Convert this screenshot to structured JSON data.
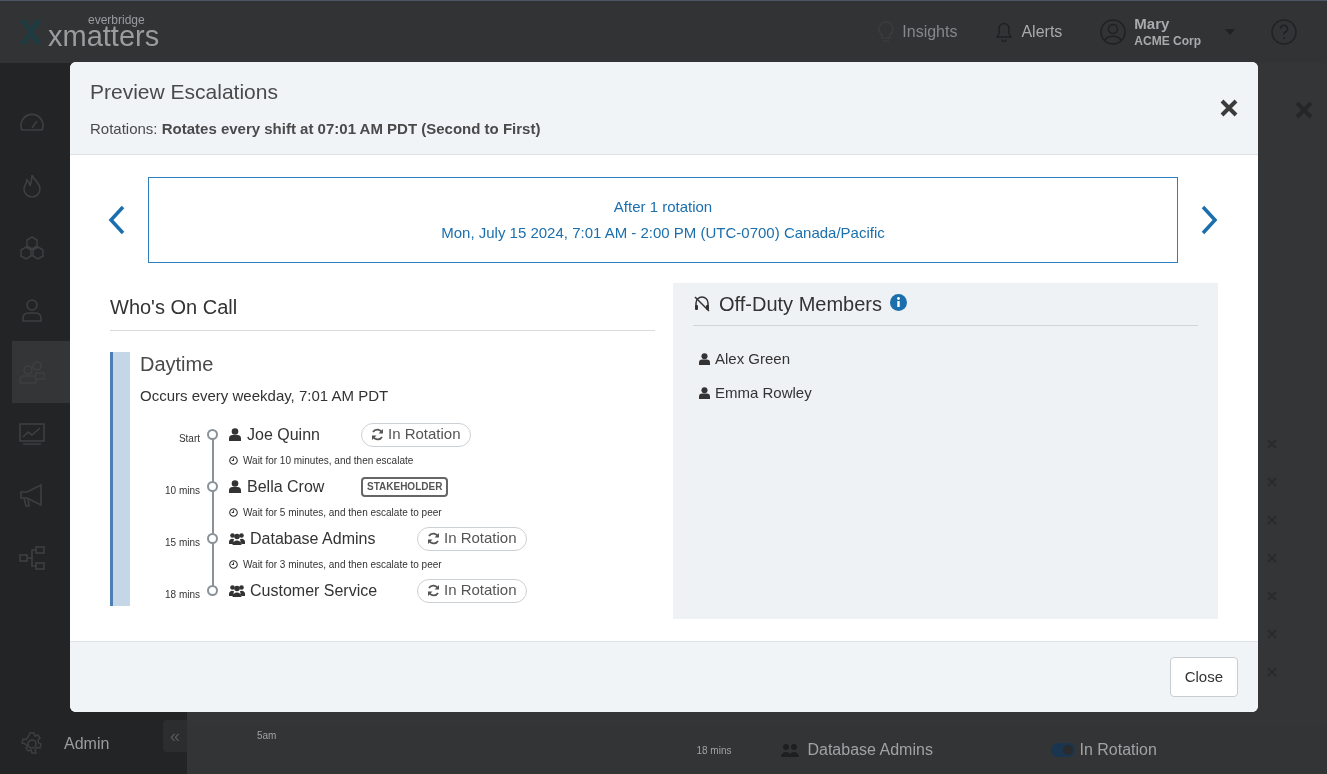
{
  "app": {
    "brand_top": "everbridge",
    "brand": "xmatters",
    "nav": [
      {
        "kind": "insights",
        "label": "Insights",
        "disabled": true
      },
      {
        "kind": "alerts",
        "label": "Alerts",
        "disabled": false
      }
    ],
    "user": {
      "name": "Mary",
      "org": "ACME Corp"
    }
  },
  "sidebar": {
    "items": [
      {
        "kind": "gauge",
        "selected": false
      },
      {
        "kind": "flame",
        "selected": false
      },
      {
        "kind": "hexagons",
        "selected": false
      },
      {
        "kind": "person",
        "selected": false
      },
      {
        "kind": "people",
        "selected": true
      },
      {
        "kind": "chart",
        "selected": false
      },
      {
        "kind": "megaphone",
        "selected": false
      },
      {
        "kind": "flow",
        "selected": false
      }
    ],
    "footer": {
      "label": "Admin",
      "collapse": "«"
    }
  },
  "background": {
    "time_label": "5am",
    "step": {
      "offset": "18 mins",
      "name": "Database Admins",
      "status": "In Rotation",
      "on": true
    }
  },
  "modal": {
    "title": "Preview Escalations",
    "subtitle_label": "Rotations:",
    "subtitle": "Rotates every shift at 07:01 AM PDT (Second to First)",
    "period": {
      "title": "After 1 rotation",
      "range": "Mon, July 15 2024, 7:01 AM - 2:00 PM (UTC-0700) Canada/Pacific"
    },
    "on_call": {
      "heading": "Who's On Call",
      "shift": {
        "name": "Daytime",
        "description": "Occurs every weekday, 7:01 AM PDT",
        "steps": [
          {
            "offset": "Start",
            "kind": "person",
            "name": "Joe Quinn",
            "badge": {
              "kind": "rotation",
              "label": "In Rotation"
            },
            "wait": "Wait for 10 minutes, and then escalate"
          },
          {
            "offset": "10 mins",
            "kind": "person",
            "name": "Bella Crow",
            "badge": {
              "kind": "role",
              "label": "STAKEHOLDER"
            },
            "wait": "Wait for 5 minutes, and then escalate to peer"
          },
          {
            "offset": "15 mins",
            "kind": "group",
            "name": "Database Admins",
            "badge": {
              "kind": "rotation",
              "label": "In Rotation"
            },
            "wait": "Wait for 3 minutes, and then escalate to peer"
          },
          {
            "offset": "18 mins",
            "kind": "group",
            "name": "Customer Service",
            "badge": {
              "kind": "rotation",
              "label": "In Rotation"
            }
          }
        ]
      }
    },
    "off_duty": {
      "heading": "Off-Duty Members",
      "members": [
        "Alex Green",
        "Emma Rowley"
      ]
    },
    "buttons": [
      "Close"
    ]
  }
}
